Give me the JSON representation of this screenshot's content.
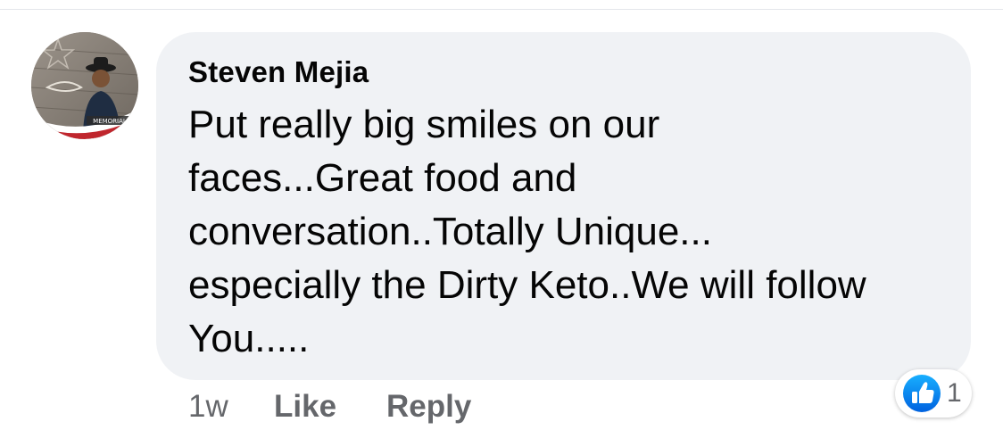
{
  "comment": {
    "author": "Steven Mejia",
    "text_lines": [
      "Put really big smiles on our",
      "faces...Great food and",
      "conversation..Totally Unique...",
      "especially the Dirty Keto..We will follow",
      "You....."
    ],
    "timestamp": "1w",
    "like_label": "Like",
    "reply_label": "Reply",
    "reaction_count": "1",
    "reaction_icon": "thumbs-up-icon",
    "avatar_banner_text": "MEMORIAL"
  },
  "colors": {
    "bubble": "#f0f2f5",
    "text": "#050505",
    "secondary_text": "#65676b",
    "like_blue": "#1877f2"
  }
}
